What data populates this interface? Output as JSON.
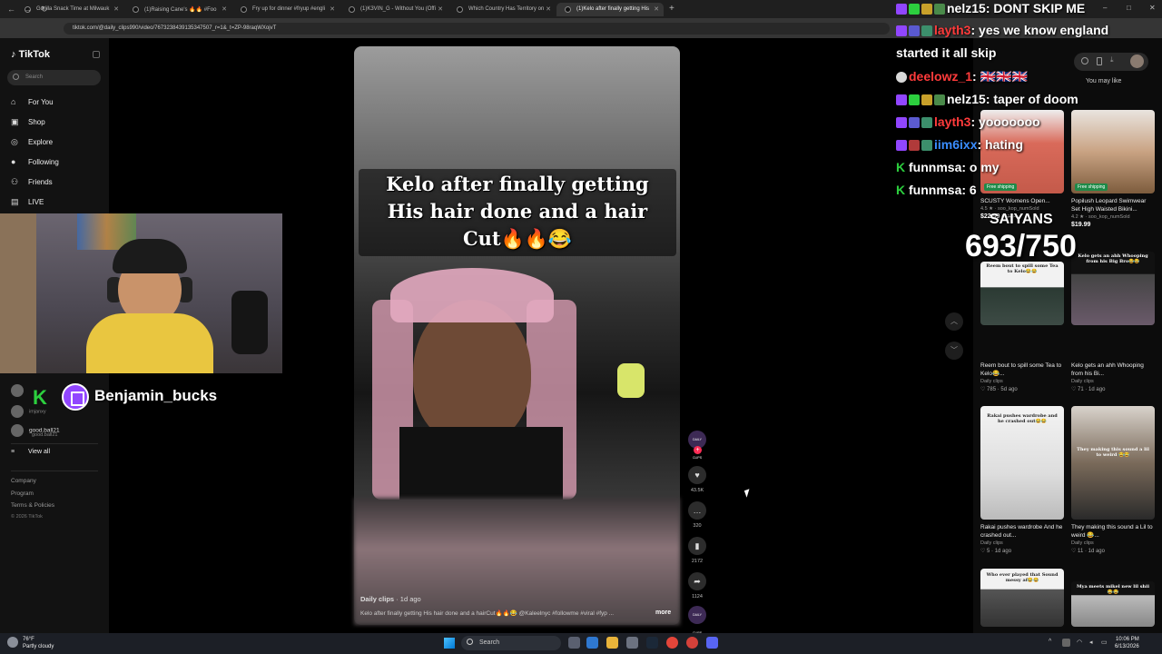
{
  "browser": {
    "tabs": [
      {
        "label": "Gorilla Snack Time at Milwauk"
      },
      {
        "label": "(1)Raising Cane's 🔥🔥 #Foo"
      },
      {
        "label": "Fry up for dinner #fryup #engli"
      },
      {
        "label": "(1)K3VIN_G - Without You (Offi"
      },
      {
        "label": "Which Country Has Territory on"
      },
      {
        "label": "(1)Kelo after finally getting His"
      }
    ],
    "url": "tiktok.com/@daily_clips990/video/7673238439135347507_r=1&_t=ZP-98raqWXojvT"
  },
  "tiktok": {
    "logo": "TikTok",
    "search_placeholder": "Search",
    "nav": [
      {
        "label": "For You",
        "icon": "home-icon"
      },
      {
        "label": "Shop",
        "icon": "shop-icon"
      },
      {
        "label": "Explore",
        "icon": "compass-icon"
      },
      {
        "label": "Following",
        "icon": "avatar-icon"
      },
      {
        "label": "Friends",
        "icon": "friends-icon"
      },
      {
        "label": "LIVE",
        "icon": "live-icon"
      }
    ],
    "following": [
      {
        "name": "imjanxy",
        "sub": ""
      },
      {
        "name": "good.ball21",
        "sub": "good.ball21"
      }
    ],
    "view_all": "View all",
    "footer": [
      "Company",
      "Program",
      "Terms & Policies",
      "© 2026 TikTok"
    ]
  },
  "stream_overlay": {
    "streamer": "Benjamin_bucks",
    "saiyans_label": "SAIYANS",
    "saiyans_count": "693/750"
  },
  "video": {
    "caption_line1": "Kelo after finally getting",
    "caption_line2": "His hair done and a hair",
    "caption_line3": "Cut🔥🔥😂",
    "author": "Daily clips",
    "age": "· 1d ago",
    "description": "Kelo after finally getting His hair done and a hairCut🔥🔥😂 @Kaleelnyc #followme #viral #fyp ...",
    "more": "more",
    "actions": {
      "likes": "43.5K",
      "comments": "320",
      "saves": "2172",
      "shares": "1124"
    },
    "creator_avatar_text": "DAILY CLIPS"
  },
  "chat": [
    {
      "user": "nelz15",
      "message": "DONT SKIP ME",
      "color": "#ffffff"
    },
    {
      "user": "layth3",
      "message": "yes we know england",
      "color": "#ff3b3b"
    },
    {
      "user": "",
      "message": "started it all skip",
      "color": "#ffffff"
    },
    {
      "user": "deelowz_1",
      "message": "🇬🇧🇬🇧🇬🇧",
      "color": "#ff3b3b"
    },
    {
      "user": "nelz15",
      "message": "taper of doom",
      "color": "#ffffff"
    },
    {
      "user": "layth3",
      "message": "yooooooo",
      "color": "#ff3b3b"
    },
    {
      "user": "iim6ixx",
      "message": "hating",
      "color": "#3a8dff"
    },
    {
      "user": "funnmsa",
      "message": "o my",
      "color": "#ffffff"
    },
    {
      "user": "funnmsa",
      "message": "6",
      "color": "#ffffff"
    }
  ],
  "right_panel": {
    "title": "You may like",
    "products": [
      {
        "title": "SCUSTY Womens Open...",
        "rating": "4.5 ★ · soo_kop_numSold",
        "price": "$22.99",
        "old_price": "$32.44",
        "badge": "Free shipping"
      },
      {
        "title": "Popilush Leopard Swimwear Set High Waisted Bikini...",
        "rating": "4.2 ★ · soo_kop_numSold",
        "price": "$19.99",
        "old_price": "",
        "badge": "Free shipping"
      }
    ],
    "videos": [
      {
        "thumb_text": "Reem bout to spill some Tea to Kelo😂😂",
        "title": "Reem bout to spill some Tea to Kelo😂...",
        "author": "Daily clips",
        "meta": "♡ 785 · 5d ago"
      },
      {
        "thumb_text": "Kelo gets an ahh Whooping from his Big Bro😂😂",
        "title": "Kelo gets an ahh Whooping from his Bi...",
        "author": "Daily clips",
        "meta": "♡ 71 · 1d ago"
      },
      {
        "thumb_text": "Rakai pushes wardrobe and he crashed out😂😂",
        "title": "Rakai pushes wardrobe And he crashed out...",
        "author": "Daily clips",
        "meta": "♡ 5 · 1d ago"
      },
      {
        "thumb_text": "They making this sound a lil to weird 😂😂",
        "title": "They making this sound a Lil to weird 😂...",
        "author": "Daily clips",
        "meta": "♡ 11 · 1d ago"
      },
      {
        "thumb_text": "Who ever played that Sound messy af😂😂",
        "title": "",
        "author": "",
        "meta": ""
      },
      {
        "thumb_text": "Mya meets mikel new lil shii😂😂",
        "title": "",
        "author": "",
        "meta": ""
      }
    ]
  },
  "taskbar": {
    "weather_temp": "76°F",
    "weather_desc": "Partly cloudy",
    "search": "Search",
    "time": "10:06 PM",
    "date": "6/13/2026"
  }
}
